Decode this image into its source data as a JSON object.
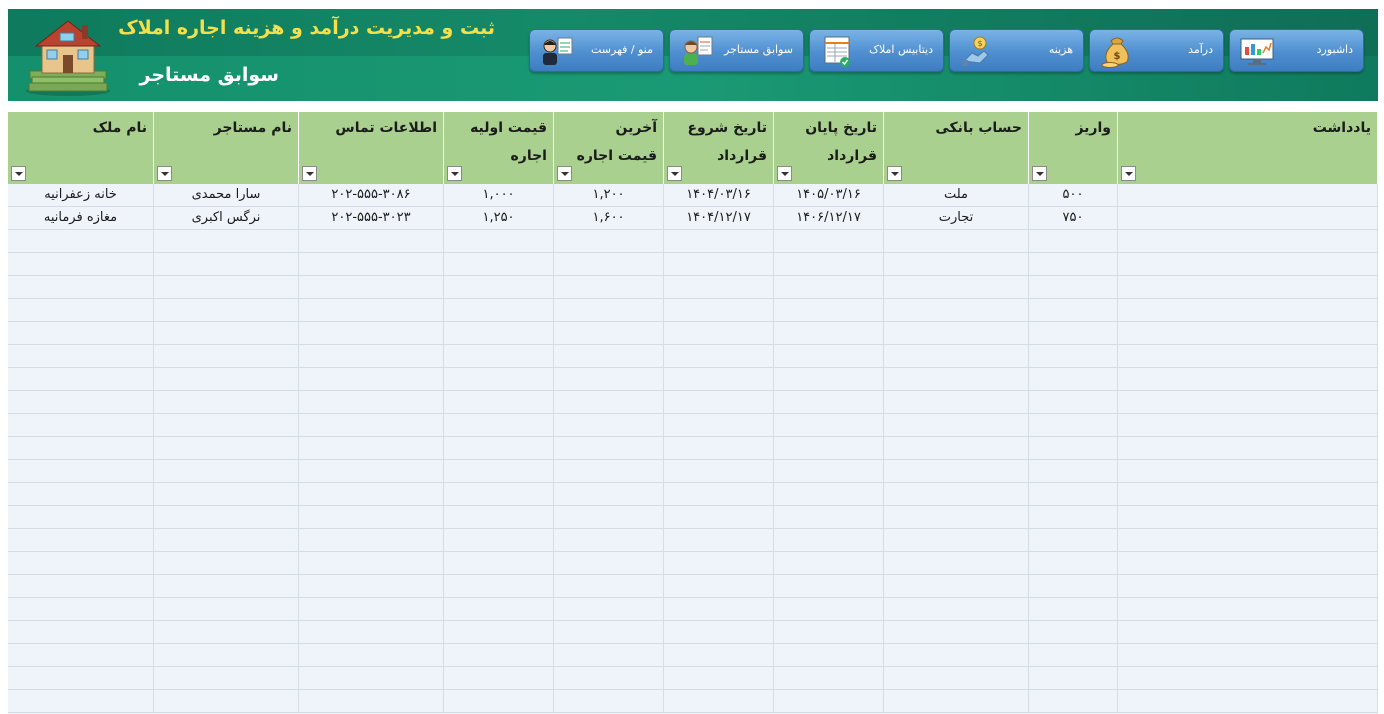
{
  "header": {
    "app_title": "ثبت و مدیریت درآمد و هزینه اجاره املاک",
    "page_title": "سوابق مستاجر"
  },
  "colors": {
    "banner": "#17916e",
    "title_accent": "#f4e04a",
    "nav_button": "#4f8fd0",
    "table_header": "#a9d08e",
    "table_body": "#eef4f9"
  },
  "nav": [
    {
      "label": "داشبورد",
      "icon": "monitor-chart-icon"
    },
    {
      "label": "درآمد",
      "icon": "money-bag-icon"
    },
    {
      "label": "هزینه",
      "icon": "expense-coin-icon"
    },
    {
      "label": "دیتابیس املاک",
      "icon": "database-sheet-icon"
    },
    {
      "label": "سوابق مستاجر",
      "icon": "tenant-records-icon"
    },
    {
      "label": "منو / فهرست",
      "icon": "menu-person-icon"
    }
  ],
  "table": {
    "columns": [
      "نام ملک",
      "نام مستاجر",
      "اطلاعات تماس",
      "قیمت اولیه اجاره",
      "آخرین قیمت اجاره",
      "تاریخ شروع قرارداد",
      "تاریخ پایان قرارداد",
      "حساب بانکی",
      "واریز",
      "یادداشت"
    ],
    "rows": [
      [
        "خانه زعفرانیه",
        "سارا محمدی",
        "۲۰۲-۵۵۵-۳۰۸۶",
        "۱,۰۰۰",
        "۱,۲۰۰",
        "۱۴۰۴/۰۳/۱۶",
        "۱۴۰۵/۰۳/۱۶",
        "ملت",
        "۵۰۰",
        ""
      ],
      [
        "مغازه فرمانیه",
        "نرگس اکبری",
        "۲۰۲-۵۵۵-۳۰۲۳",
        "۱,۲۵۰",
        "۱,۶۰۰",
        "۱۴۰۴/۱۲/۱۷",
        "۱۴۰۶/۱۲/۱۷",
        "تجارت",
        "۷۵۰",
        ""
      ]
    ]
  }
}
